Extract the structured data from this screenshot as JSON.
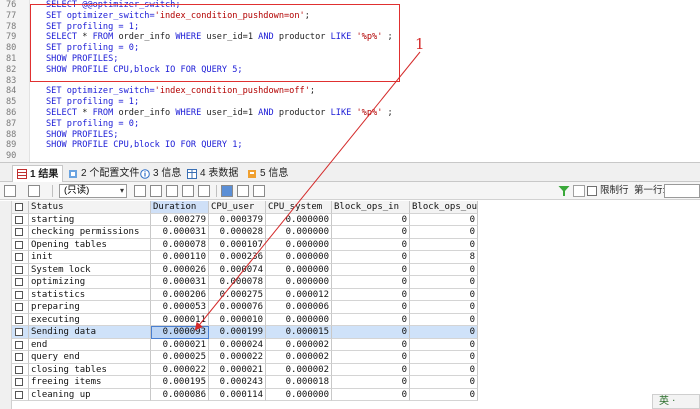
{
  "editor": {
    "lines": [
      {
        "num": "76",
        "parts": [
          {
            "t": "SELECT @@optimizer_switch;",
            "k": "kw"
          }
        ]
      },
      {
        "num": "77",
        "parts": [
          {
            "t": "SET optimizer_switch=",
            "k": "kw"
          },
          {
            "t": "'index_condition_pushdown=on'",
            "k": "str"
          },
          {
            "t": ";",
            "k": ""
          }
        ]
      },
      {
        "num": "78",
        "parts": [
          {
            "t": "SET profiling = 1;",
            "k": "kw"
          }
        ]
      },
      {
        "num": "79",
        "parts": [
          {
            "t": "SELECT",
            "k": "kw"
          },
          {
            "t": " * ",
            "k": ""
          },
          {
            "t": "FROM",
            "k": "kw"
          },
          {
            "t": " order_info ",
            "k": ""
          },
          {
            "t": "WHERE",
            "k": "kw"
          },
          {
            "t": " user_id=1 ",
            "k": ""
          },
          {
            "t": "AND",
            "k": "kw"
          },
          {
            "t": " productor ",
            "k": ""
          },
          {
            "t": "LIKE",
            "k": "kw"
          },
          {
            "t": " '%p%'",
            "k": "str"
          },
          {
            "t": " ;",
            "k": ""
          }
        ]
      },
      {
        "num": "80",
        "parts": [
          {
            "t": "SET profiling = 0;",
            "k": "kw"
          }
        ]
      },
      {
        "num": "81",
        "parts": [
          {
            "t": "SHOW PROFILES;",
            "k": "kw"
          }
        ]
      },
      {
        "num": "82",
        "parts": [
          {
            "t": "SHOW PROFILE CPU,block IO FOR QUERY 5;",
            "k": "kw"
          }
        ]
      },
      {
        "num": "83",
        "parts": []
      },
      {
        "num": "84",
        "parts": [
          {
            "t": "SET optimizer_switch=",
            "k": "kw"
          },
          {
            "t": "'index_condition_pushdown=off'",
            "k": "str"
          },
          {
            "t": ";",
            "k": ""
          }
        ]
      },
      {
        "num": "85",
        "parts": [
          {
            "t": "SET profiling = 1;",
            "k": "kw"
          }
        ]
      },
      {
        "num": "86",
        "parts": [
          {
            "t": "SELECT",
            "k": "kw"
          },
          {
            "t": " * ",
            "k": ""
          },
          {
            "t": "FROM",
            "k": "kw"
          },
          {
            "t": " order_info ",
            "k": ""
          },
          {
            "t": "WHERE",
            "k": "kw"
          },
          {
            "t": " user_id=1 ",
            "k": ""
          },
          {
            "t": "AND",
            "k": "kw"
          },
          {
            "t": " productor ",
            "k": ""
          },
          {
            "t": "LIKE",
            "k": "kw"
          },
          {
            "t": " '%p%'",
            "k": "str"
          },
          {
            "t": " ;",
            "k": ""
          }
        ]
      },
      {
        "num": "87",
        "parts": [
          {
            "t": "SET profiling = 0;",
            "k": "kw"
          }
        ]
      },
      {
        "num": "88",
        "parts": [
          {
            "t": "SHOW PROFILES;",
            "k": "kw"
          }
        ]
      },
      {
        "num": "89",
        "parts": [
          {
            "t": "SHOW PROFILE CPU,block IO FOR QUERY 1;",
            "k": "kw"
          }
        ]
      },
      {
        "num": "90",
        "parts": []
      }
    ],
    "annotation_number": "1"
  },
  "tabs": [
    {
      "label": "1 结果",
      "icon": "grid-icon"
    },
    {
      "label": "2 个配置文件",
      "icon": "profile-icon"
    },
    {
      "label": "3 信息",
      "icon": "info-icon"
    },
    {
      "label": "4 表数据",
      "icon": "table-icon"
    },
    {
      "label": "5 信息",
      "icon": "info-orange-icon"
    }
  ],
  "toolbar": {
    "mode_select": "(只读)",
    "limit_label": "限制行",
    "next_row_label": "第一行:"
  },
  "grid": {
    "columns": [
      "Status",
      "Duration",
      "CPU_user",
      "CPU_system",
      "Block_ops_in",
      "Block_ops_out"
    ],
    "rows": [
      [
        "starting",
        "0.000279",
        "0.000379",
        "0.000000",
        "0",
        "0"
      ],
      [
        "checking permissions",
        "0.000031",
        "0.000028",
        "0.000000",
        "0",
        "0"
      ],
      [
        "Opening tables",
        "0.000078",
        "0.000107",
        "0.000000",
        "0",
        "0"
      ],
      [
        "init",
        "0.000110",
        "0.000236",
        "0.000000",
        "0",
        "8"
      ],
      [
        "System lock",
        "0.000026",
        "0.000074",
        "0.000000",
        "0",
        "0"
      ],
      [
        "optimizing",
        "0.000031",
        "0.000078",
        "0.000000",
        "0",
        "0"
      ],
      [
        "statistics",
        "0.000206",
        "0.000275",
        "0.000012",
        "0",
        "0"
      ],
      [
        "preparing",
        "0.000053",
        "0.000076",
        "0.000006",
        "0",
        "0"
      ],
      [
        "executing",
        "0.000011",
        "0.000010",
        "0.000000",
        "0",
        "0"
      ],
      [
        "Sending data",
        "0.000093",
        "0.000199",
        "0.000015",
        "0",
        "0"
      ],
      [
        "end",
        "0.000021",
        "0.000024",
        "0.000002",
        "0",
        "0"
      ],
      [
        "query end",
        "0.000025",
        "0.000022",
        "0.000002",
        "0",
        "0"
      ],
      [
        "closing tables",
        "0.000022",
        "0.000021",
        "0.000002",
        "0",
        "0"
      ],
      [
        "freeing items",
        "0.000195",
        "0.000243",
        "0.000018",
        "0",
        "0"
      ],
      [
        "cleaning up",
        "0.000086",
        "0.000114",
        "0.000000",
        "0",
        "0"
      ]
    ],
    "selected_row": 9
  },
  "ime": {
    "label": "英 ·"
  },
  "colors": {
    "annotation": "#d42a2a",
    "keyword": "#1b1bd6",
    "string": "#b20000",
    "selection": "#cfe2f9"
  }
}
